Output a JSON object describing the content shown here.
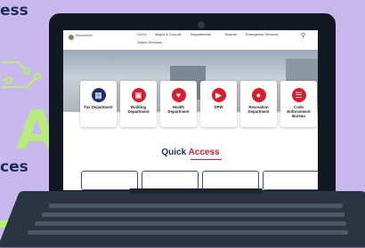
{
  "background": {
    "top_word": "ess",
    "mid_word": "ces",
    "ai_text": "AI",
    "accent": "#b6f36a",
    "bg": "#c9b8ee"
  },
  "nav": {
    "logo_text": "Bloomfield",
    "items": [
      {
        "label": "Home",
        "active": true
      },
      {
        "label": "Mayor & Council"
      },
      {
        "label": "Departments"
      },
      {
        "label": "Boards"
      },
      {
        "label": "Emergency Services"
      }
    ],
    "row2": "Online Services",
    "search_icon": "search-icon"
  },
  "cards": [
    {
      "label": "Tax Department",
      "icon": "tax-icon"
    },
    {
      "label": "Building Department",
      "icon": "building-icon"
    },
    {
      "label": "Health Department",
      "icon": "heart-icon"
    },
    {
      "label": "DPW",
      "icon": "truck-icon"
    },
    {
      "label": "Recreation Department",
      "icon": "people-icon"
    },
    {
      "label": "Code Enforcement Bureau",
      "icon": "document-icon"
    }
  ],
  "quick_access": {
    "first": "Quick ",
    "second": "Access"
  },
  "colors": {
    "brand_red": "#d81e2a",
    "brand_navy": "#1e2f66"
  }
}
